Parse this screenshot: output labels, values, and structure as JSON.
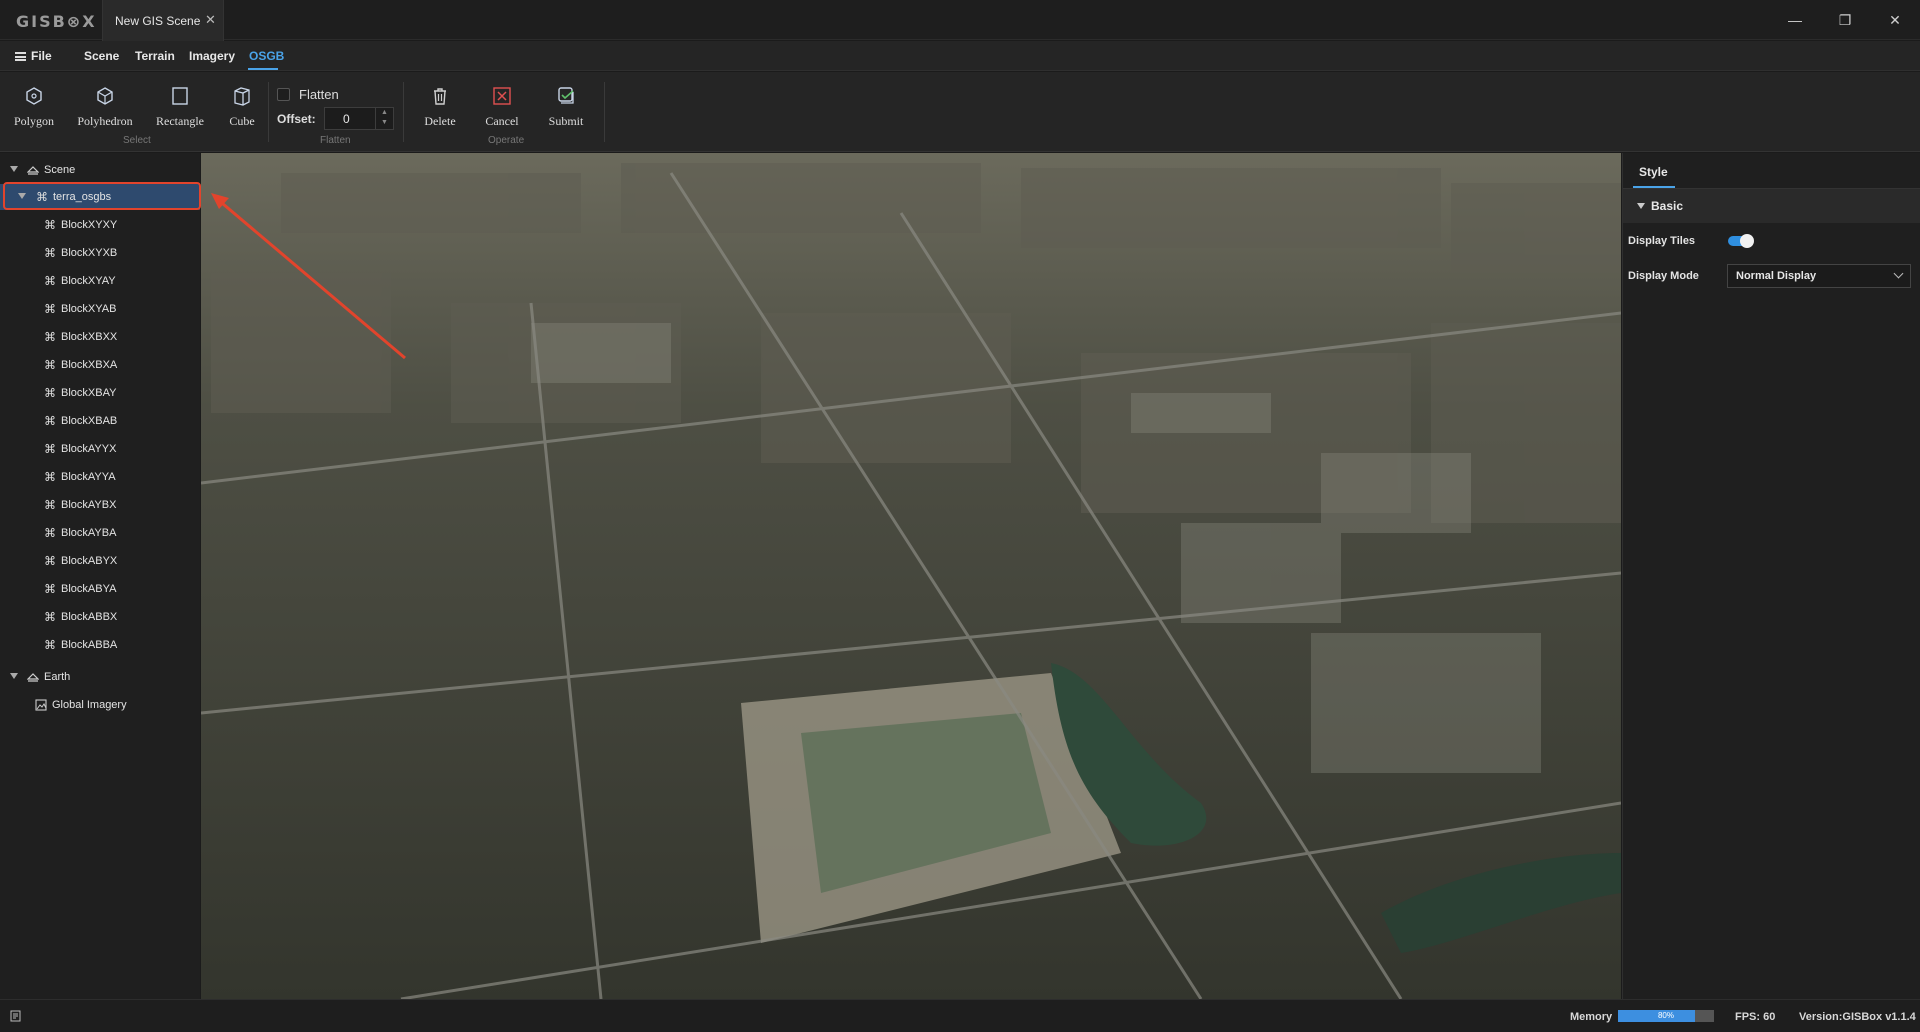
{
  "app": {
    "logo": "GISB⊗X",
    "document_tab": "New GIS Scene",
    "close_glyph": "✕"
  },
  "window_controls": {
    "minimize": "—",
    "restore": "❐",
    "close": "✕"
  },
  "menu": {
    "file": "File",
    "tabs": [
      "Scene",
      "Terrain",
      "Imagery",
      "OSGB"
    ],
    "active_tab": "OSGB"
  },
  "ribbon": {
    "select_tools": [
      "Polygon",
      "Polyhedron",
      "Rectangle",
      "Cube"
    ],
    "select_group": "Select",
    "flatten_label": "Flatten",
    "flatten_checked": false,
    "offset_label": "Offset:",
    "offset_value": "0",
    "flatten_group": "Flatten",
    "operate_tools": [
      "Delete",
      "Cancel",
      "Submit"
    ],
    "operate_group": "Operate"
  },
  "tree": {
    "scene": "Scene",
    "selected_node": "terra_osgbs",
    "blocks": [
      "BlockXYXY",
      "BlockXYXB",
      "BlockXYAY",
      "BlockXYAB",
      "BlockXBXX",
      "BlockXBXA",
      "BlockXBAY",
      "BlockXBAB",
      "BlockAYYX",
      "BlockAYYA",
      "BlockAYBX",
      "BlockAYBA",
      "BlockABYX",
      "BlockABYA",
      "BlockABBX",
      "BlockABBA"
    ],
    "earth": "Earth",
    "imagery": "Global Imagery"
  },
  "properties": {
    "tab": "Style",
    "section": "Basic",
    "display_tiles_label": "Display Tiles",
    "display_tiles_on": true,
    "display_mode_label": "Display Mode",
    "display_mode_value": "Normal Display"
  },
  "status": {
    "memory_label": "Memory",
    "memory_percent": "80%",
    "memory_fraction": 0.8,
    "fps": "FPS: 60",
    "version": "Version:GISBox v1.1.4"
  },
  "colors": {
    "accent": "#4aa3e8",
    "highlight_annotation": "#e2442c",
    "selected_row": "#2e4a6e"
  }
}
